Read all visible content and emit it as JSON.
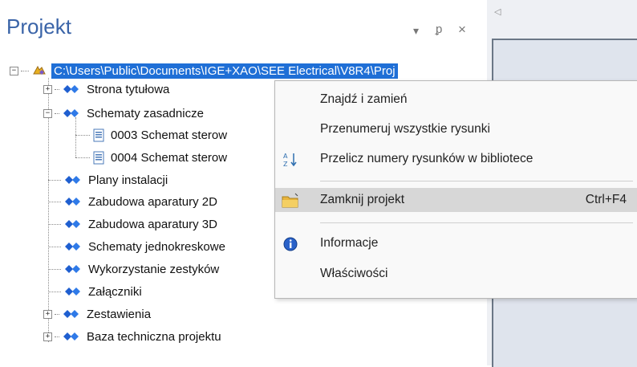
{
  "panel": {
    "title": "Projekt",
    "pin_glyph": "ᵖ",
    "dropdown_glyph": "▾",
    "close_glyph": "×"
  },
  "tree": {
    "root": "C:\\Users\\Public\\Documents\\IGE+XAO\\SEE Electrical\\V8R4\\Proj",
    "items": [
      {
        "label": "Strona tytułowa",
        "expander": "+"
      },
      {
        "label": "Schematy zasadnicze",
        "expander": "−"
      },
      {
        "label": "0003 Schemat sterow"
      },
      {
        "label": "0004 Schemat sterow"
      },
      {
        "label": "Plany instalacji"
      },
      {
        "label": "Zabudowa aparatury 2D"
      },
      {
        "label": "Zabudowa aparatury 3D"
      },
      {
        "label": "Schematy jednokreskowe"
      },
      {
        "label": "Wykorzystanie zestyków"
      },
      {
        "label": "Załączniki"
      },
      {
        "label": "Zestawienia",
        "expander": "+"
      },
      {
        "label": "Baza techniczna projektu",
        "expander": "+"
      }
    ]
  },
  "context_menu": {
    "find_replace": "Znajdź i zamień",
    "renumber_all": "Przenumeruj wszystkie rysunki",
    "recalc_numbers": "Przelicz numery rysunków w bibliotece",
    "close_project": "Zamknij projekt",
    "close_project_shortcut": "Ctrl+F4",
    "information": "Informacje",
    "properties": "Właściwości"
  },
  "colors": {
    "selection": "#1f6fd6",
    "title": "#3a64a8",
    "menu_highlight": "#d7d7d7"
  },
  "icons": [
    "project-root-icon",
    "category-icon",
    "drawing-page-icon",
    "sort-az-icon",
    "folder-close-icon",
    "info-icon"
  ]
}
